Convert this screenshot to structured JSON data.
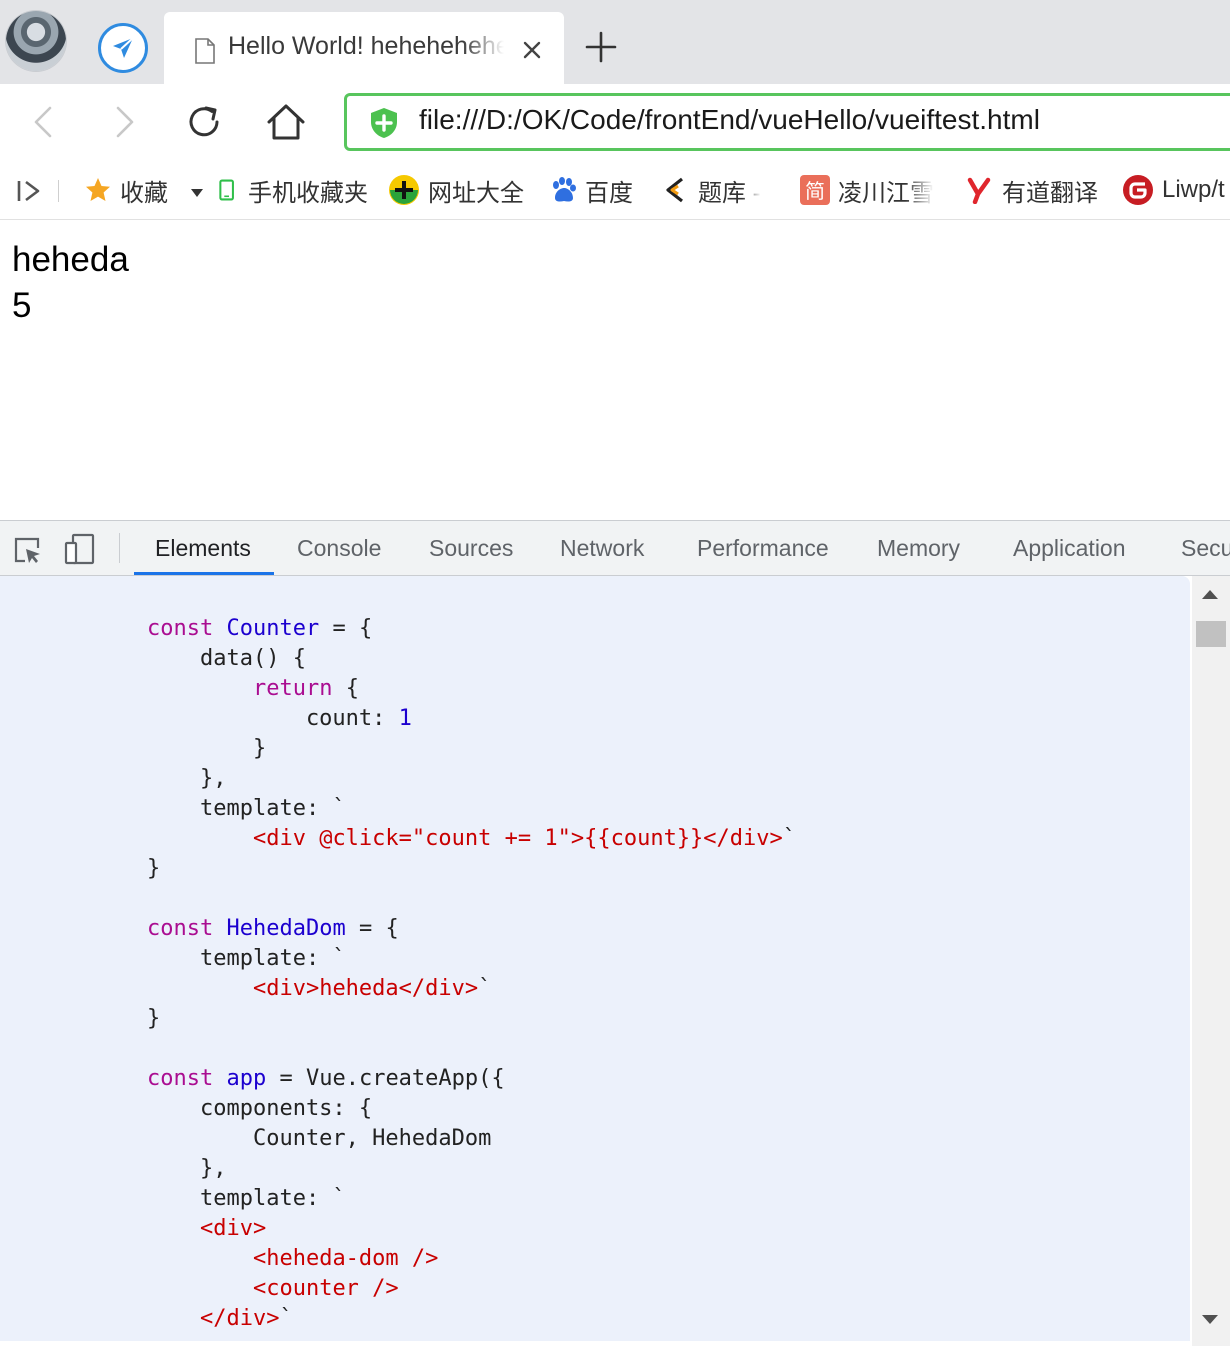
{
  "browser": {
    "tab": {
      "title": "Hello World! hehehehehe"
    },
    "address": {
      "url": "file:///D:/OK/Code/frontEnd/vueHello/vueiftest.html"
    },
    "bookmarks": [
      {
        "label": "收藏",
        "icon": "star-icon"
      },
      {
        "label": "手机收藏夹",
        "icon": "phone-icon"
      },
      {
        "label": "网址大全",
        "icon": "url-directory-icon"
      },
      {
        "label": "百度",
        "icon": "baidu-paw-icon"
      },
      {
        "label": "题库 -",
        "icon": "question-bank-icon"
      },
      {
        "label": "凌川江雪",
        "icon": "jianshu-icon"
      },
      {
        "label": "有道翻译",
        "icon": "youdao-icon"
      },
      {
        "label": "Liwp/t",
        "icon": "gitee-icon"
      }
    ]
  },
  "page": {
    "output": [
      "heheda",
      "5"
    ]
  },
  "devtools": {
    "tabs": [
      "Elements",
      "Console",
      "Sources",
      "Network",
      "Performance",
      "Memory",
      "Application",
      "Secu"
    ],
    "active_tab": "Elements"
  },
  "colors": {
    "accent": "#1a73e8",
    "address_border": "#58c55d",
    "keyword": "#aa0d91",
    "definition": "#1c00cf",
    "string": "#c80000",
    "source_bg": "#ecf1fb"
  }
}
